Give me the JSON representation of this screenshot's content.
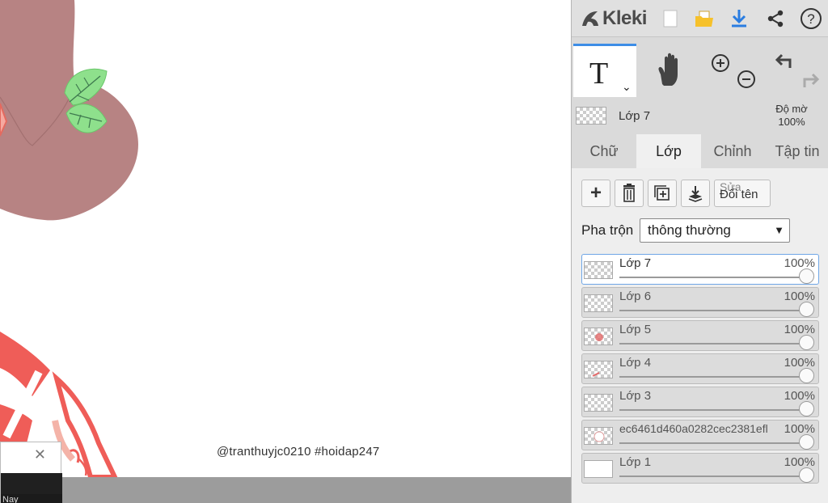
{
  "canvas": {
    "watermark": "@tranthuyjc0210 #hoidap247"
  },
  "mini_window": {
    "close_glyph": "✕",
    "bottom_text": "Nay"
  },
  "topbar": {
    "logo_text": "Kleki",
    "icons": [
      "new-image-icon",
      "open-folder-icon",
      "download-icon",
      "share-icon",
      "help-icon"
    ],
    "help_glyph": "?"
  },
  "tools": {
    "text_tool_glyph": "T",
    "text_tool_chevron": "⌄",
    "accent_color": "#3d8de6"
  },
  "current_layer": {
    "name": "Lớp 7",
    "opacity_label": "Độ mờ",
    "opacity_value": "100%"
  },
  "tabs": [
    {
      "label": "Chữ",
      "active": false
    },
    {
      "label": "Lớp",
      "active": true
    },
    {
      "label": "Chỉnh",
      "active": false
    },
    {
      "label": "Tập tin",
      "active": false
    }
  ],
  "layer_buttons": {
    "add_glyph": "+",
    "rename_top": "Sửa",
    "rename_label": "Đổi tên"
  },
  "blend": {
    "label": "Pha trộn",
    "value": "thông thường"
  },
  "layers": [
    {
      "name": "Lớp 7",
      "opacity": "100%",
      "selected": true
    },
    {
      "name": "Lớp 6",
      "opacity": "100%",
      "selected": false
    },
    {
      "name": "Lớp 5",
      "opacity": "100%",
      "selected": false
    },
    {
      "name": "Lớp 4",
      "opacity": "100%",
      "selected": false
    },
    {
      "name": "Lớp 3",
      "opacity": "100%",
      "selected": false
    },
    {
      "name": "ec6461d460a0282cec2381efl",
      "opacity": "100%",
      "selected": false
    },
    {
      "name": "Lớp 1",
      "opacity": "100%",
      "selected": false
    }
  ]
}
